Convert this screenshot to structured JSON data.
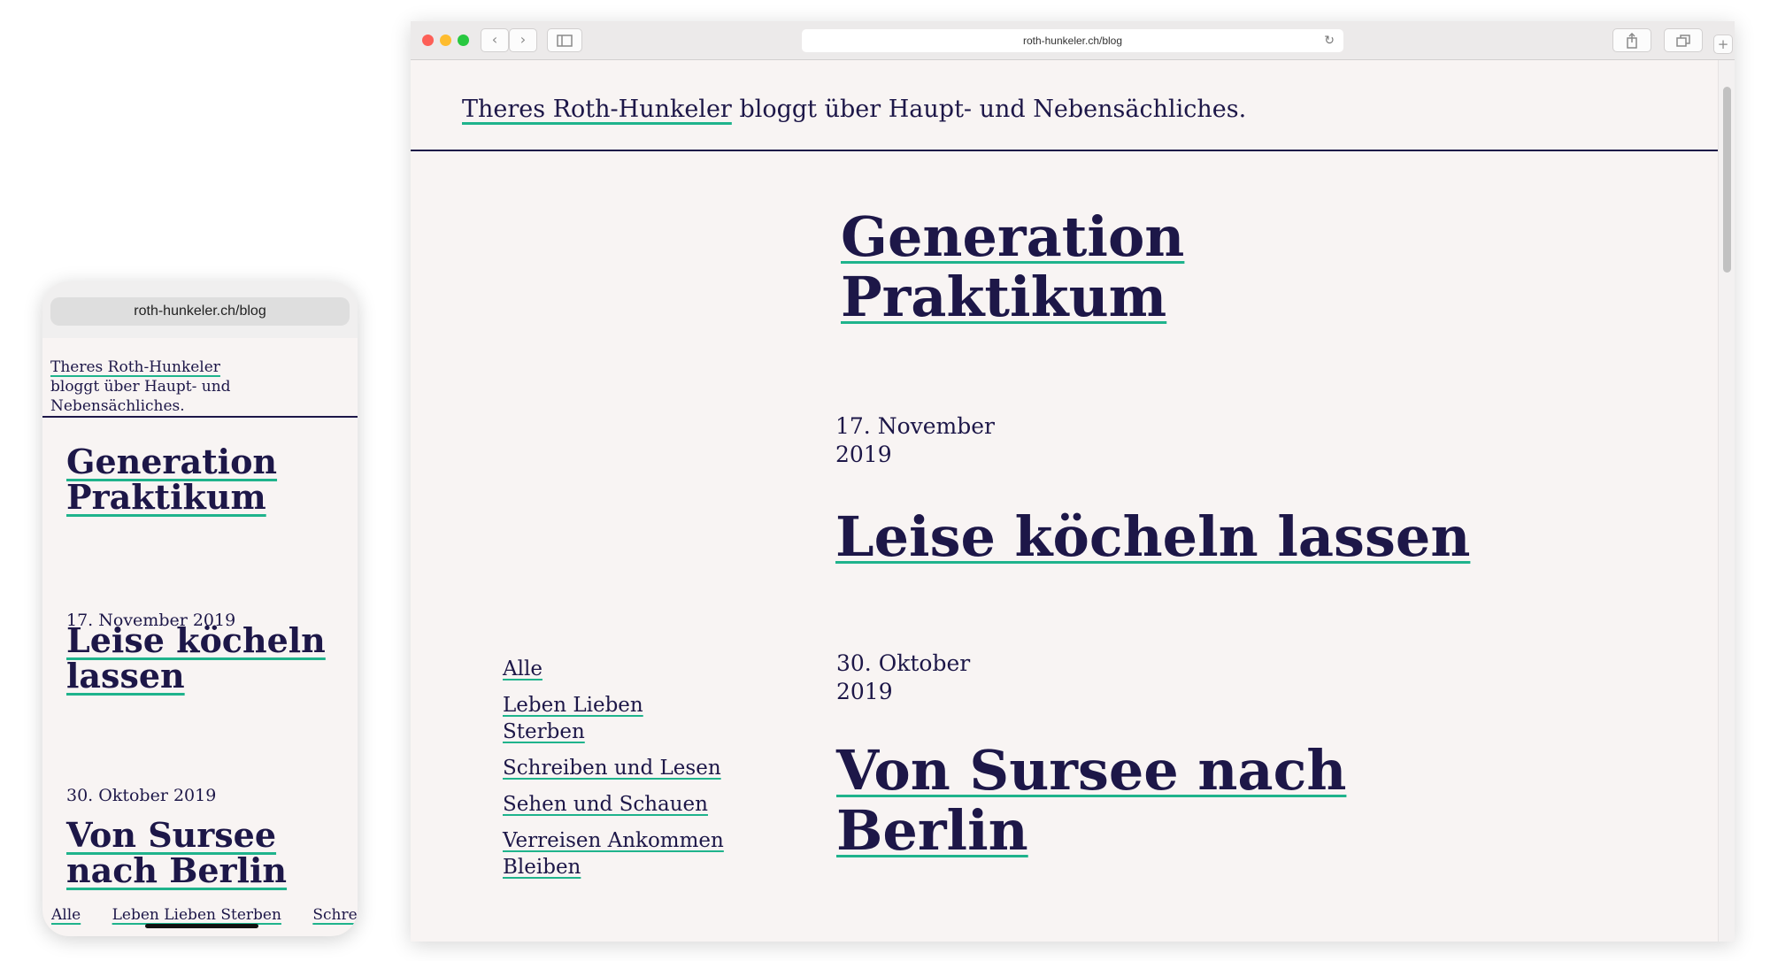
{
  "site": {
    "author_link": "Theres Roth-Hunkeler",
    "tagline": "bloggt über Haupt- und Nebensächliches.",
    "posts": [
      {
        "title": "Generation Praktikum",
        "date": "17. November 2019"
      },
      {
        "title": "Leise köcheln lassen",
        "date": "30. Oktober 2019"
      },
      {
        "title": "Von Sursee nach Berlin"
      }
    ],
    "categories": [
      "Alle",
      "Leben Lieben Sterben",
      "Schreiben und Lesen",
      "Sehen und Schauen",
      "Verreisen Ankommen Bleiben"
    ]
  },
  "mobile": {
    "url": "roth-hunkeler.ch/blog",
    "tagline": "bloggt über Haupt- und Nebensächliches.",
    "categories": [
      "Alle",
      "Leben Lieben Sterben",
      "Schreib"
    ],
    "post_titles": [
      "Generation Praktikum",
      "Leise köcheln lassen",
      "Von Sursee nach Berlin"
    ],
    "dates": [
      "17. November 2019",
      "30. Oktober 2019"
    ]
  },
  "browser": {
    "url": "roth-hunkeler.ch/blog",
    "icons": {
      "reload": "reload-icon",
      "share": "share-icon",
      "tabs": "tabs-icon",
      "new_tab": "plus-icon",
      "sidebar": "sidebar-icon",
      "back": "chevron-left-icon",
      "forward": "chevron-right-icon"
    }
  },
  "colors": {
    "text": "#1d1748",
    "underline": "#1fb38c",
    "background": "#f8f4f3"
  }
}
